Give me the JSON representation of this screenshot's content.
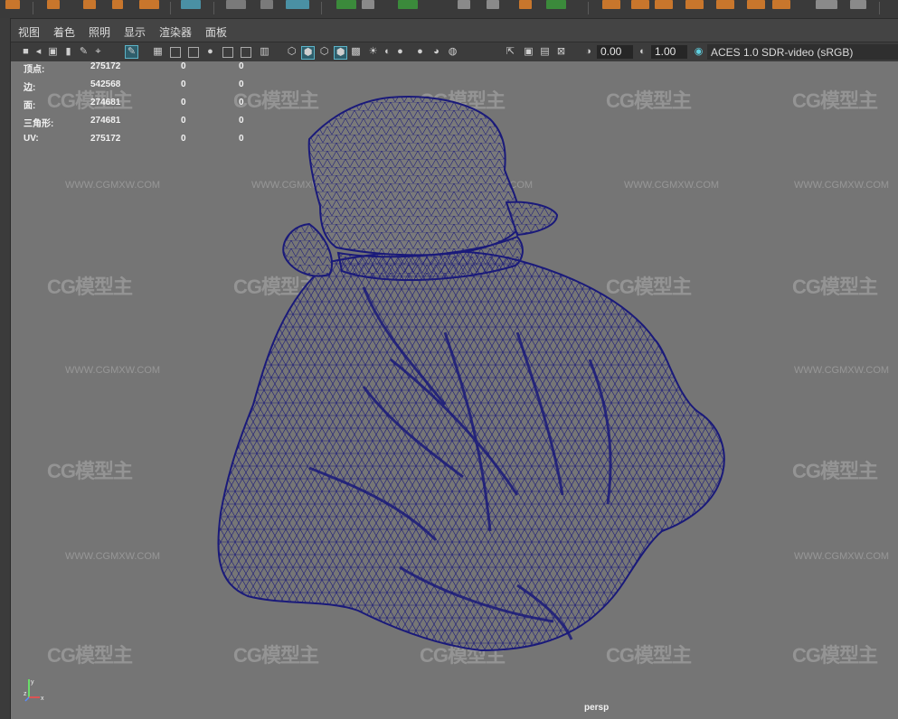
{
  "menu": {
    "view": "视图",
    "shading": "着色",
    "lighting": "照明",
    "show": "显示",
    "renderer": "渲染器",
    "panels": "面板"
  },
  "toolbar": {
    "field_a": "0.00",
    "field_b": "1.00",
    "color_space": "ACES 1.0 SDR-video (sRGB)",
    "icons": [
      "select-camera-icon",
      "camera-attributes-icon",
      "bookmark-icon",
      "image-plane-icon",
      "grease-pencil-icon",
      "2d-pan-zoom-icon",
      "grid-icon",
      "film-gate-icon",
      "resolution-gate-icon",
      "gate-mask-icon",
      "field-chart-icon",
      "safe-action-icon",
      "wireframe-icon",
      "smooth-shade-icon",
      "wireframe-on-shaded-icon",
      "textured-icon",
      "use-all-lights-icon",
      "shadows-icon",
      "screen-space-ao-icon",
      "motion-blur-icon",
      "anti-aliasing-icon",
      "isolate-select-icon",
      "xray-icon",
      "xray-joints-icon",
      "exposure-icon",
      "gamma-icon",
      "color-management-icon"
    ]
  },
  "hud": {
    "rows": [
      {
        "label": "顶点:",
        "v1": "275172",
        "v2": "0",
        "v3": "0"
      },
      {
        "label": "边:",
        "v1": "542568",
        "v2": "0",
        "v3": "0"
      },
      {
        "label": "面:",
        "v1": "274681",
        "v2": "0",
        "v3": "0"
      },
      {
        "label": "三角形:",
        "v1": "274681",
        "v2": "0",
        "v3": "0"
      },
      {
        "label": "UV:",
        "v1": "275172",
        "v2": "0",
        "v3": "0"
      }
    ]
  },
  "viewport": {
    "camera": "persp",
    "background_color": "#757575",
    "wire_color": "#1a1a7a",
    "axis": {
      "x": "x",
      "y": "y",
      "z": "z"
    }
  },
  "watermark": {
    "logo": "CG模型主",
    "url": "WWW.CGMXW.COM"
  }
}
